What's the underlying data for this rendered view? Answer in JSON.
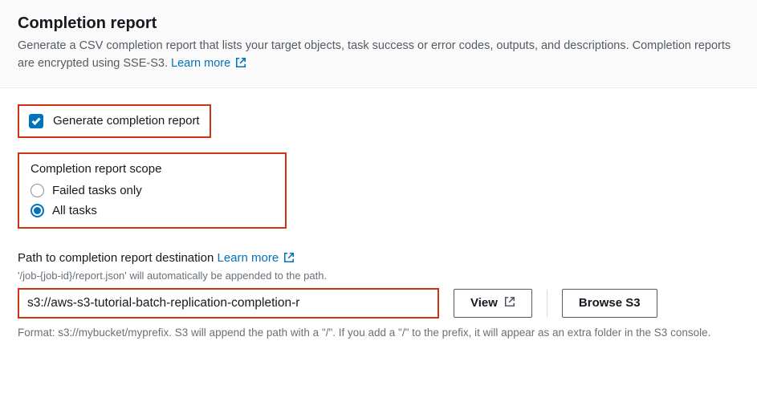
{
  "header": {
    "title": "Completion report",
    "description_part1": "Generate a CSV completion report that lists your target objects, task success or error codes, outputs, and descriptions. Completion reports are encrypted using SSE-S3. ",
    "learn_more": "Learn more"
  },
  "checkbox": {
    "label": "Generate completion report",
    "checked": true
  },
  "scope": {
    "title": "Completion report scope",
    "options": {
      "failed": "Failed tasks only",
      "all": "All tasks"
    },
    "selected": "all"
  },
  "path": {
    "label": "Path to completion report destination",
    "learn_more": "Learn more",
    "hint": "'/job-{job-id}/report.json' will automatically be appended to the path.",
    "value": "s3://aws-s3-tutorial-batch-replication-completion-r",
    "view_button": "View",
    "browse_button": "Browse S3",
    "format_hint": "Format: s3://mybucket/myprefix. S3 will append the path with a \"/\". If you add a \"/\" to the prefix, it will appear as an extra folder in the S3 console."
  }
}
